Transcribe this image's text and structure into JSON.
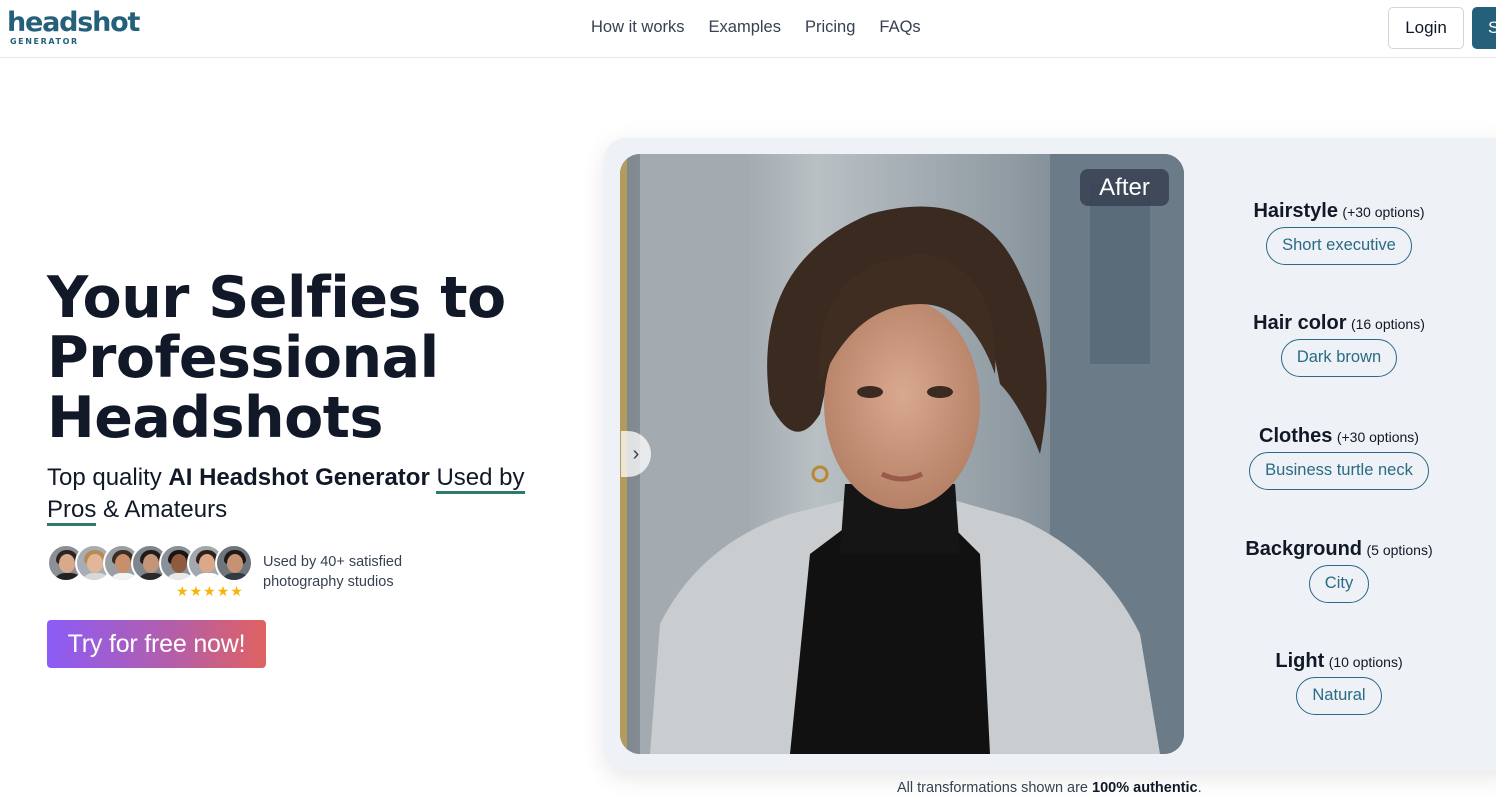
{
  "header": {
    "logo_main": "headshot",
    "logo_sub": "GENERATOR",
    "nav": [
      "How it works",
      "Examples",
      "Pricing",
      "FAQs"
    ],
    "login_label": "Login",
    "signup_label": "S"
  },
  "hero": {
    "title_lines": [
      "Your Selfies to",
      "Professional",
      "Headshots"
    ],
    "subtitle_prefix": "Top quality ",
    "subtitle_bold": "AI Headshot Generator",
    "subtitle_used_by": "Used by",
    "subtitle_pros": "Pros",
    "subtitle_suffix": " & Amateurs",
    "used_by_text": "Used by 40+ satisfied photography studios",
    "rating_stars": 5,
    "cta_label": "Try for free now!"
  },
  "preview": {
    "badge": "After",
    "options": [
      {
        "title": "Hairstyle",
        "count": "(+30 options)",
        "value": "Short executive"
      },
      {
        "title": "Hair color",
        "count": "(16 options)",
        "value": "Dark brown"
      },
      {
        "title": "Clothes",
        "count": "(+30 options)",
        "value": "Business turtle neck"
      },
      {
        "title": "Background",
        "count": "(5 options)",
        "value": "City"
      },
      {
        "title": "Light",
        "count": "(10 options)",
        "value": "Natural"
      }
    ]
  },
  "footer_note": {
    "prefix": "All transformations shown are ",
    "bold": "100% authentic",
    "suffix": "."
  },
  "colors": {
    "brand": "#24607a",
    "accent_underline": "#2d7a6e",
    "cta_gradient_start": "#8b5cf6",
    "cta_gradient_end": "#e0625f",
    "star": "#f5b60b"
  }
}
